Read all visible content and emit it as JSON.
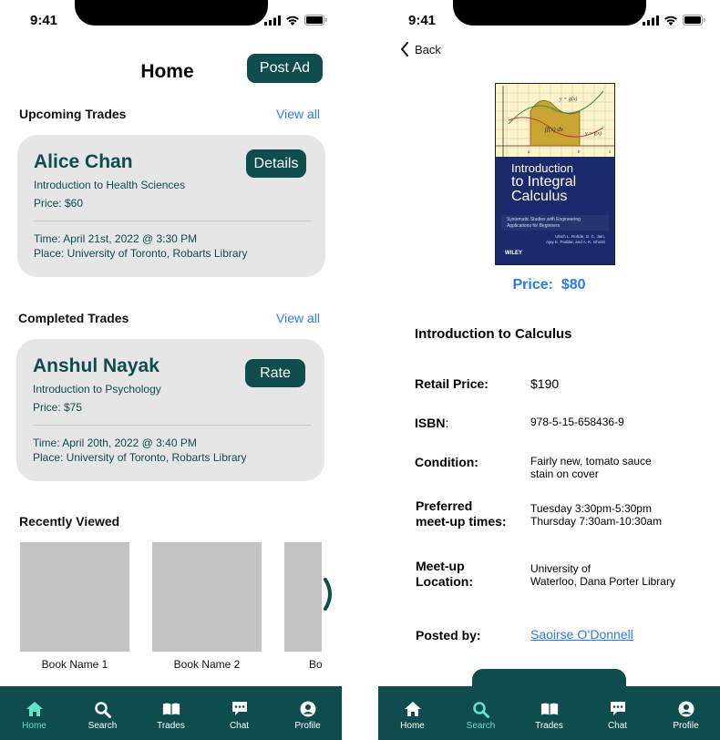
{
  "status_bar": {
    "time": "9:41"
  },
  "colors": {
    "primary": "#0e4c4e",
    "accent_link": "#2c7be5",
    "tab_active": "#5fe3c9",
    "card_bg": "#e6e6e6",
    "placeholder": "#c4c4c4"
  },
  "home": {
    "title": "Home",
    "post_ad_label": "Post Ad",
    "upcoming": {
      "title": "Upcoming Trades",
      "view_all": "View all",
      "card": {
        "name": "Alice Chan",
        "course": "Introduction to Health Sciences",
        "price": "Price: $60",
        "time": "Time: April 21st, 2022 @ 3:30 PM",
        "place": "Place: University of Toronto, Robarts Library",
        "button": "Details"
      }
    },
    "completed": {
      "title": "Completed Trades",
      "view_all": "View all",
      "card": {
        "name": "Anshul Nayak",
        "course": "Introduction to Psychology",
        "price": "Price: $75",
        "time": "Time: April 20th, 2022 @ 3:40 PM",
        "place": "Place: University of Toronto, Robarts Library",
        "button": "Rate"
      }
    },
    "recently_viewed": {
      "title": "Recently Viewed",
      "books": [
        "Book Name 1",
        "Book Name 2",
        "Bo"
      ],
      "arrow_icon": "chevron-right-icon"
    }
  },
  "detail": {
    "back_label": "Back",
    "cover": {
      "formula_top": "y = g(x)",
      "formula_integral": "∫f(x) dx",
      "formula_bottom": "y = f(x)",
      "axis_a": "a",
      "axis_b": "b",
      "axis_x": "x",
      "title_line1": "Introduction",
      "title_line2": "to Integral",
      "title_line3": "Calculus",
      "subtitle": "Systematic Studies with Engineering Applications for Beginners",
      "authors_line1": "Ulrich L. Rohde, G. C. Jain,",
      "authors_line2": "Ajay K. Poddar, and A. K. Ghosh",
      "publisher": "WILEY"
    },
    "price_label": "Price:",
    "price_value": "$80",
    "book_title": "Introduction to Calculus",
    "fields": {
      "retail_label": "Retail Price:",
      "retail_value": "$190",
      "isbn_label": "ISBN",
      "isbn_colon": ":",
      "isbn_value": "978-5-15-658436-9",
      "condition_label": "Condition:",
      "condition_value_1": "Fairly new, tomato sauce",
      "condition_value_2": "stain on cover",
      "meetup_times_label_1": "Preferred",
      "meetup_times_label_2": "meet-up times:",
      "meetup_times_value_1": "Tuesday 3:30pm-5:30pm",
      "meetup_times_value_2": "Thursday 7:30am-10:30am",
      "meetup_location_label_1": "Meet-up",
      "meetup_location_label_2": "Location:",
      "meetup_location_value_1": "University of",
      "meetup_location_value_2": "Waterloo, Dana Porter Library",
      "posted_by_label": "Posted by:",
      "posted_by_value": "Saoirse O’Donnell"
    }
  },
  "tabs": [
    {
      "label": "Home",
      "icon": "home-icon"
    },
    {
      "label": "Search",
      "icon": "search-icon"
    },
    {
      "label": "Trades",
      "icon": "book-icon"
    },
    {
      "label": "Chat",
      "icon": "chat-icon"
    },
    {
      "label": "Profile",
      "icon": "profile-icon"
    }
  ],
  "left_active_tab": "Home",
  "right_active_tab": "Search"
}
